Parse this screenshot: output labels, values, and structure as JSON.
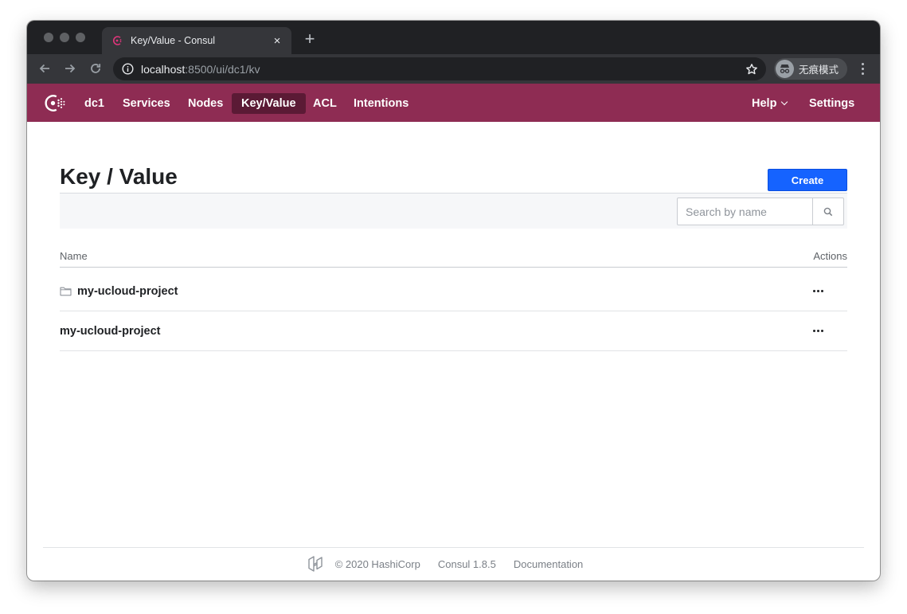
{
  "browser": {
    "tab_title": "Key/Value - Consul",
    "close_glyph": "×",
    "new_tab_glyph": "+",
    "url_host": "localhost",
    "url_path": ":8500/ui/dc1/kv",
    "incognito_label": "无痕模式"
  },
  "nav": {
    "datacenter": "dc1",
    "items": [
      "Services",
      "Nodes",
      "Key/Value",
      "ACL",
      "Intentions"
    ],
    "active": "Key/Value",
    "help": "Help",
    "settings": "Settings"
  },
  "page": {
    "title": "Key / Value",
    "create_label": "Create",
    "search_placeholder": "Search by name"
  },
  "table": {
    "columns": [
      "Name",
      "Actions"
    ],
    "rows": [
      {
        "name": "my-ucloud-project",
        "is_folder": true,
        "icon": "folder-icon"
      },
      {
        "name": "my-ucloud-project",
        "is_folder": false
      }
    ]
  },
  "footer": {
    "copyright": "© 2020 HashiCorp",
    "version": "Consul 1.8.5",
    "docs": "Documentation"
  },
  "colors": {
    "brand": "#8e2c53",
    "nav_active": "#5b1a35",
    "primary_button": "#1563ff"
  }
}
